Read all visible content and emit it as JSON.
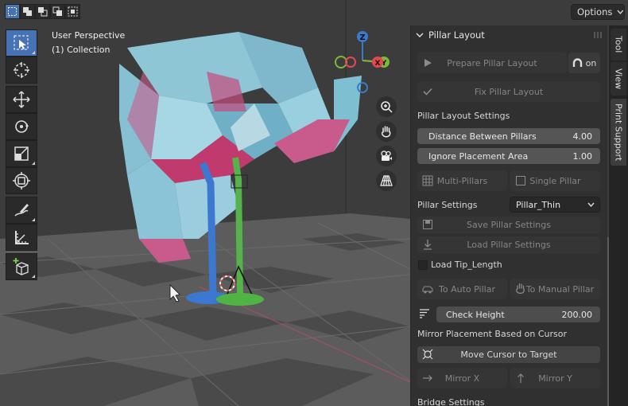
{
  "viewport": {
    "perspective_label": "User Perspective",
    "collection_label": "(1) Collection",
    "options_label": "Options",
    "gizmo": {
      "x_label": "X",
      "y_label": "Y",
      "z_label": "Z",
      "x_color": "#e84552",
      "y_color": "#7cb83a",
      "z_color": "#3b79cf"
    },
    "selection_modes": [
      "select-box-icon",
      "select-extend-icon",
      "select-subtract-icon",
      "select-invert-icon",
      "select-intersect-icon"
    ],
    "tools": [
      "select-box-icon",
      "cursor-icon",
      "move-icon",
      "rotate-icon",
      "scale-icon",
      "transform-icon",
      "annotate-icon",
      "measure-icon",
      "add-cube-icon"
    ],
    "nav_buttons": [
      "zoom-icon",
      "pan-hand-icon",
      "camera-icon",
      "grid-perspective-icon"
    ]
  },
  "panel": {
    "title": "Pillar Layout",
    "prepare_label": "Prepare Pillar Layout",
    "toggle_label": "on",
    "fix_label": "Fix Pillar Layout",
    "settings_heading": "Pillar Layout Settings",
    "distance_label": "Distance Between Pillars",
    "distance_value": "4.00",
    "ignore_label": "Ignore Placement Area",
    "ignore_value": "1.00",
    "multi_label": "Multi-Pillars",
    "single_label": "Single Pillar",
    "pillar_settings_label": "Pillar Settings",
    "pillar_settings_value": "Pillar_Thin",
    "save_label": "Save Pillar Settings",
    "load_label": "Load Pillar Settings",
    "load_tip_label": "Load Tip_Length",
    "auto_label": "To Auto Pillar",
    "manual_label": "To Manual Pillar",
    "check_height_label": "Check Height",
    "check_height_value": "200.00",
    "mirror_heading": "Mirror Placement Based on Cursor",
    "move_cursor_label": "Move Cursor to Target",
    "mirror_x_label": "Mirror X",
    "mirror_y_label": "Mirror Y",
    "bridge_heading": "Bridge Settings"
  },
  "side_tabs": {
    "tool": "Tool",
    "view": "View",
    "print_support": "Print Support"
  }
}
